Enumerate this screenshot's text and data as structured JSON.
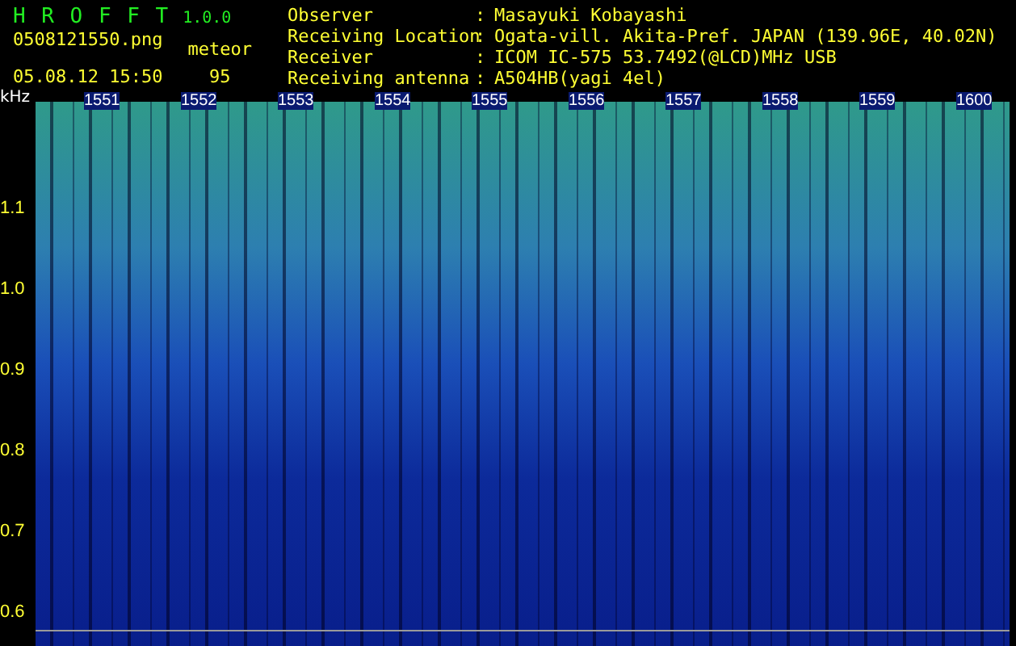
{
  "app": {
    "name": "H R O F F T",
    "version": "1.0.0",
    "filename": "0508121550.png",
    "datetime": "05.08.12 15:50",
    "mode_label": "meteor",
    "count": "95"
  },
  "info": [
    {
      "label": "Observer",
      "separator": ":",
      "value": "Masayuki Kobayashi"
    },
    {
      "label": "Receiving Location",
      "separator": ":",
      "value": "Ogata-vill. Akita-Pref. JAPAN (139.96E, 40.02N)"
    },
    {
      "label": "Receiver",
      "separator": ":",
      "value": "ICOM IC-575 53.7492(@LCD)MHz USB"
    },
    {
      "label": "Receiving antenna",
      "separator": ":",
      "value": "A504HB(yagi 4el)"
    }
  ],
  "plot": {
    "y_unit": "kHz",
    "y_labels": [
      "1.1",
      "1.0",
      "0.9",
      "0.8",
      "0.7",
      "0.6"
    ],
    "time_labels": [
      "1551",
      "1552",
      "1553",
      "1554",
      "1555",
      "1556",
      "1557",
      "1558",
      "1559",
      "1600"
    ]
  }
}
